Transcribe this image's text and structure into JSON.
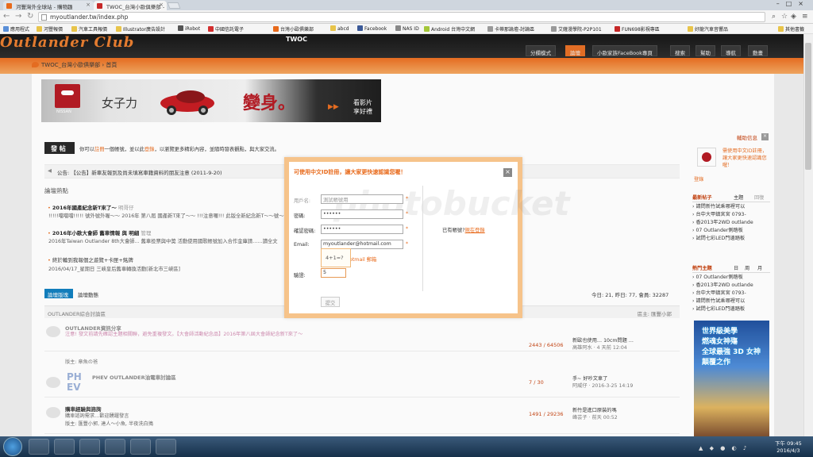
{
  "browser": {
    "tabs": [
      {
        "label": "河豐灣外全球站 - 購物趣",
        "active": false
      },
      {
        "label": "TWOC_台灣小歐俱樂部 -",
        "active": true
      }
    ],
    "url": "myoutlander.tw/index.php",
    "bookmarks": [
      "應用程式",
      "河豐報價",
      "汽車工具報價",
      "Illustrator廣告設計",
      "iRobot",
      "中國信託電子",
      "台灣小歐俱樂部",
      "abcd",
      "Facebook",
      "NAS ID",
      "Android 台灣中文網",
      "卡蒂那論壇-討論區",
      "艾薩漫學院-P2P101",
      "FUN698影視專區",
      "好龍汽車音響品",
      "其他書籤"
    ]
  },
  "site": {
    "logo": "Outlander Club",
    "logo_sub": "TWOC",
    "nav": [
      "分欄模式",
      "論壇",
      "小歐家族FaceBook專頁",
      "搜索",
      "幫助",
      "導航",
      "動畫"
    ],
    "nav_active": "論壇",
    "breadcrumb": "TWOC_台灣小歐俱樂部 › 首頁"
  },
  "ad": {
    "brand": "NISSAN",
    "text1": "女子力",
    "text2": "變身。",
    "text3a": "看影片",
    "text3b": "享好禮"
  },
  "post": {
    "button": "發 帖",
    "note_pre": "你可以",
    "note_register": "註冊",
    "note_mid": "一個帳號，並以此",
    "note_login": "登錄",
    "note_post": "，以瀏覽更多精彩內容，並隨時發表觀點，與大家交流。"
  },
  "notice": "公告: 【公告】新車友報到及尚未填寫車籍資料的朋友注意 (2011-9-20)",
  "hot": {
    "title": "論壇熱點",
    "items": [
      {
        "title": "2016年國產紀念新T來了～",
        "author": "明哥仔",
        "summary": "!!!!!噹噹噹!!!!! 號外號外喔～～ 2016年 第八屆 國產新T來了～～ !!!注意囉!!! 此版全新紀念新T～～號～～版……讀全文"
      },
      {
        "title": "2016年小歐大會師 舊車情報 與 明細",
        "author": "管理",
        "summary": "2016年Taiwan Outlander 8th大會師... 舊車投票與中獎 活動使用國歌帳號加入合作金庫請……讀全文"
      },
      {
        "title": "終於輪到我報個之遊覽+卡匣+銘牌",
        "author": "",
        "summary": "2016/04/17_星期日 三峽皇后舊車轉換活動[新北市三峽區]"
      }
    ]
  },
  "tabs": {
    "active": "論壇版塊",
    "other": "論壇動態"
  },
  "stats": "今日: 21, 昨日: 77, 會員: 32287",
  "forum": {
    "section": "OUTLANDER綜合討論區",
    "section_right": "區主: 匯豐小郭",
    "rows": [
      {
        "title": "OUTLANDER資訊分享",
        "mod": "注意! 發文前請先確認主題相關聯，避免重複發文。【大會師活動紀念品】2016年第八屆大會師紀念新T來了～",
        "sub": "版主: 章魚の爸",
        "count": "2443 / 64506",
        "last": "新歐也使用… 10cm問題 …",
        "last_by": "高雄阿水 · 4 天前 12:04"
      },
      {
        "title": "PHEV OUTLANDER油電車討論區",
        "mod": "",
        "sub": "",
        "count": "7 / 30",
        "last": "手~ 好吵文車了",
        "last_by": "阿威仔 · 2016-3-25 14:19"
      },
      {
        "title": "購車經驗與諮詢",
        "mod": "購車諮詢需求…歡迎踴躍發言",
        "sub": "版主: 匯豐小郭, 達人～小魚, 半夜洗白搗",
        "count": "1491 / 29236",
        "last": "新竹是進口原裝的嗎",
        "last_by": "峰芸子 · 前天 00:52"
      }
    ]
  },
  "sidebar": {
    "head": "輔助信息",
    "link": "需使用中文ID註冊，讓大家更快速認識您喔！",
    "more": "登錄",
    "newest": {
      "title": "最新帖子",
      "tab1": "主題",
      "tab2": "回復",
      "items": [
        "請問新竹試乘哪裡可以",
        "台中大甲鎮宮宮 0793-",
        "香2013年2WD outlande",
        "07 Outlander側踏板",
        "試問七彩LED門邊踏板"
      ]
    },
    "hot": {
      "title": "熱門主題",
      "tab1": "日",
      "tab2": "周",
      "tab3": "月",
      "items": [
        "07 Outlander側踏板",
        "香2013年2WD outlande",
        "台中大甲鎮宮宮 0793-",
        "請問新竹試乘哪裡可以",
        "試問七彩LED門邊踏板"
      ]
    },
    "game": [
      "世界級美學",
      "燃魂女神殤",
      "全球最強 3D 女神",
      "顛覆之作"
    ]
  },
  "dialog": {
    "title": "可使用中文ID註冊，讓大家更快速認識您喔！",
    "user_label": "用戶名:",
    "user_value": "測試帳號用",
    "pwd_label": "密碼:",
    "pwd_value": "••••••",
    "pwd2_label": "確認密碼:",
    "pwd2_value": "••••••",
    "email_label": "Email:",
    "email_value": "myoutlander@hotmail.com",
    "email_suggest": "hotmail 郵箱",
    "captcha_q": "4+1=?",
    "verify_label": "驗證:",
    "verify_value": "5",
    "submit": "提交",
    "has_account": "已有帳號?",
    "login_now": "現在登錄",
    "close": "×"
  },
  "taskbar": {
    "time": "下午 09:45",
    "date": "2016/4/3"
  }
}
